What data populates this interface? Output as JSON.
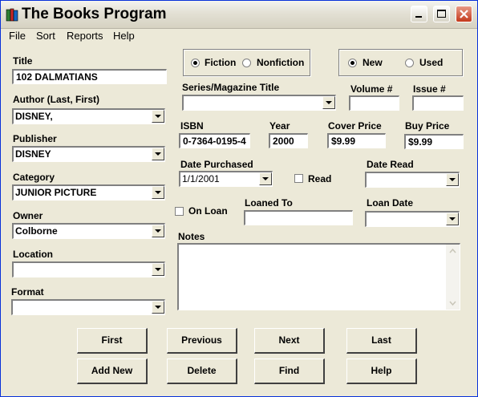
{
  "window": {
    "title": "The Books Program"
  },
  "menu": [
    "File",
    "Sort",
    "Reports",
    "Help"
  ],
  "form": {
    "title_label": "Title",
    "title_value": "102 DALMATIANS",
    "author_label": "Author (Last, First)",
    "author_value": "DISNEY,",
    "publisher_label": "Publisher",
    "publisher_value": "DISNEY",
    "category_label": "Category",
    "category_value": "JUNIOR PICTURE",
    "owner_label": "Owner",
    "owner_value": "Colborne",
    "location_label": "Location",
    "location_value": "",
    "format_label": "Format",
    "format_value": "",
    "genre_fiction": "Fiction",
    "genre_nonfiction": "Nonfiction",
    "genre_selected": "Fiction",
    "cond_new": "New",
    "cond_used": "Used",
    "cond_selected": "New",
    "series_label": "Series/Magazine Title",
    "series_value": "",
    "volume_label": "Volume #",
    "volume_value": "",
    "issue_label": "Issue #",
    "issue_value": "",
    "isbn_label": "ISBN",
    "isbn_value": "0-7364-0195-4",
    "year_label": "Year",
    "year_value": "2000",
    "cover_label": "Cover Price",
    "cover_value": "$9.99",
    "buy_label": "Buy Price",
    "buy_value": "$9.99",
    "date_purchased_label": "Date Purchased",
    "date_purchased_value": "1/1/2001",
    "read_label": "Read",
    "read_checked": false,
    "date_read_label": "Date Read",
    "date_read_value": "",
    "on_loan_label": "On Loan",
    "on_loan_checked": false,
    "loaned_to_label": "Loaned To",
    "loaned_to_value": "",
    "loan_date_label": "Loan Date",
    "loan_date_value": "",
    "notes_label": "Notes",
    "notes_value": ""
  },
  "buttons": {
    "first": "First",
    "previous": "Previous",
    "next": "Next",
    "last": "Last",
    "add_new": "Add New",
    "delete": "Delete",
    "find": "Find",
    "help": "Help"
  },
  "colors": {
    "face": "#ece9d8",
    "close": "#c4391b"
  }
}
